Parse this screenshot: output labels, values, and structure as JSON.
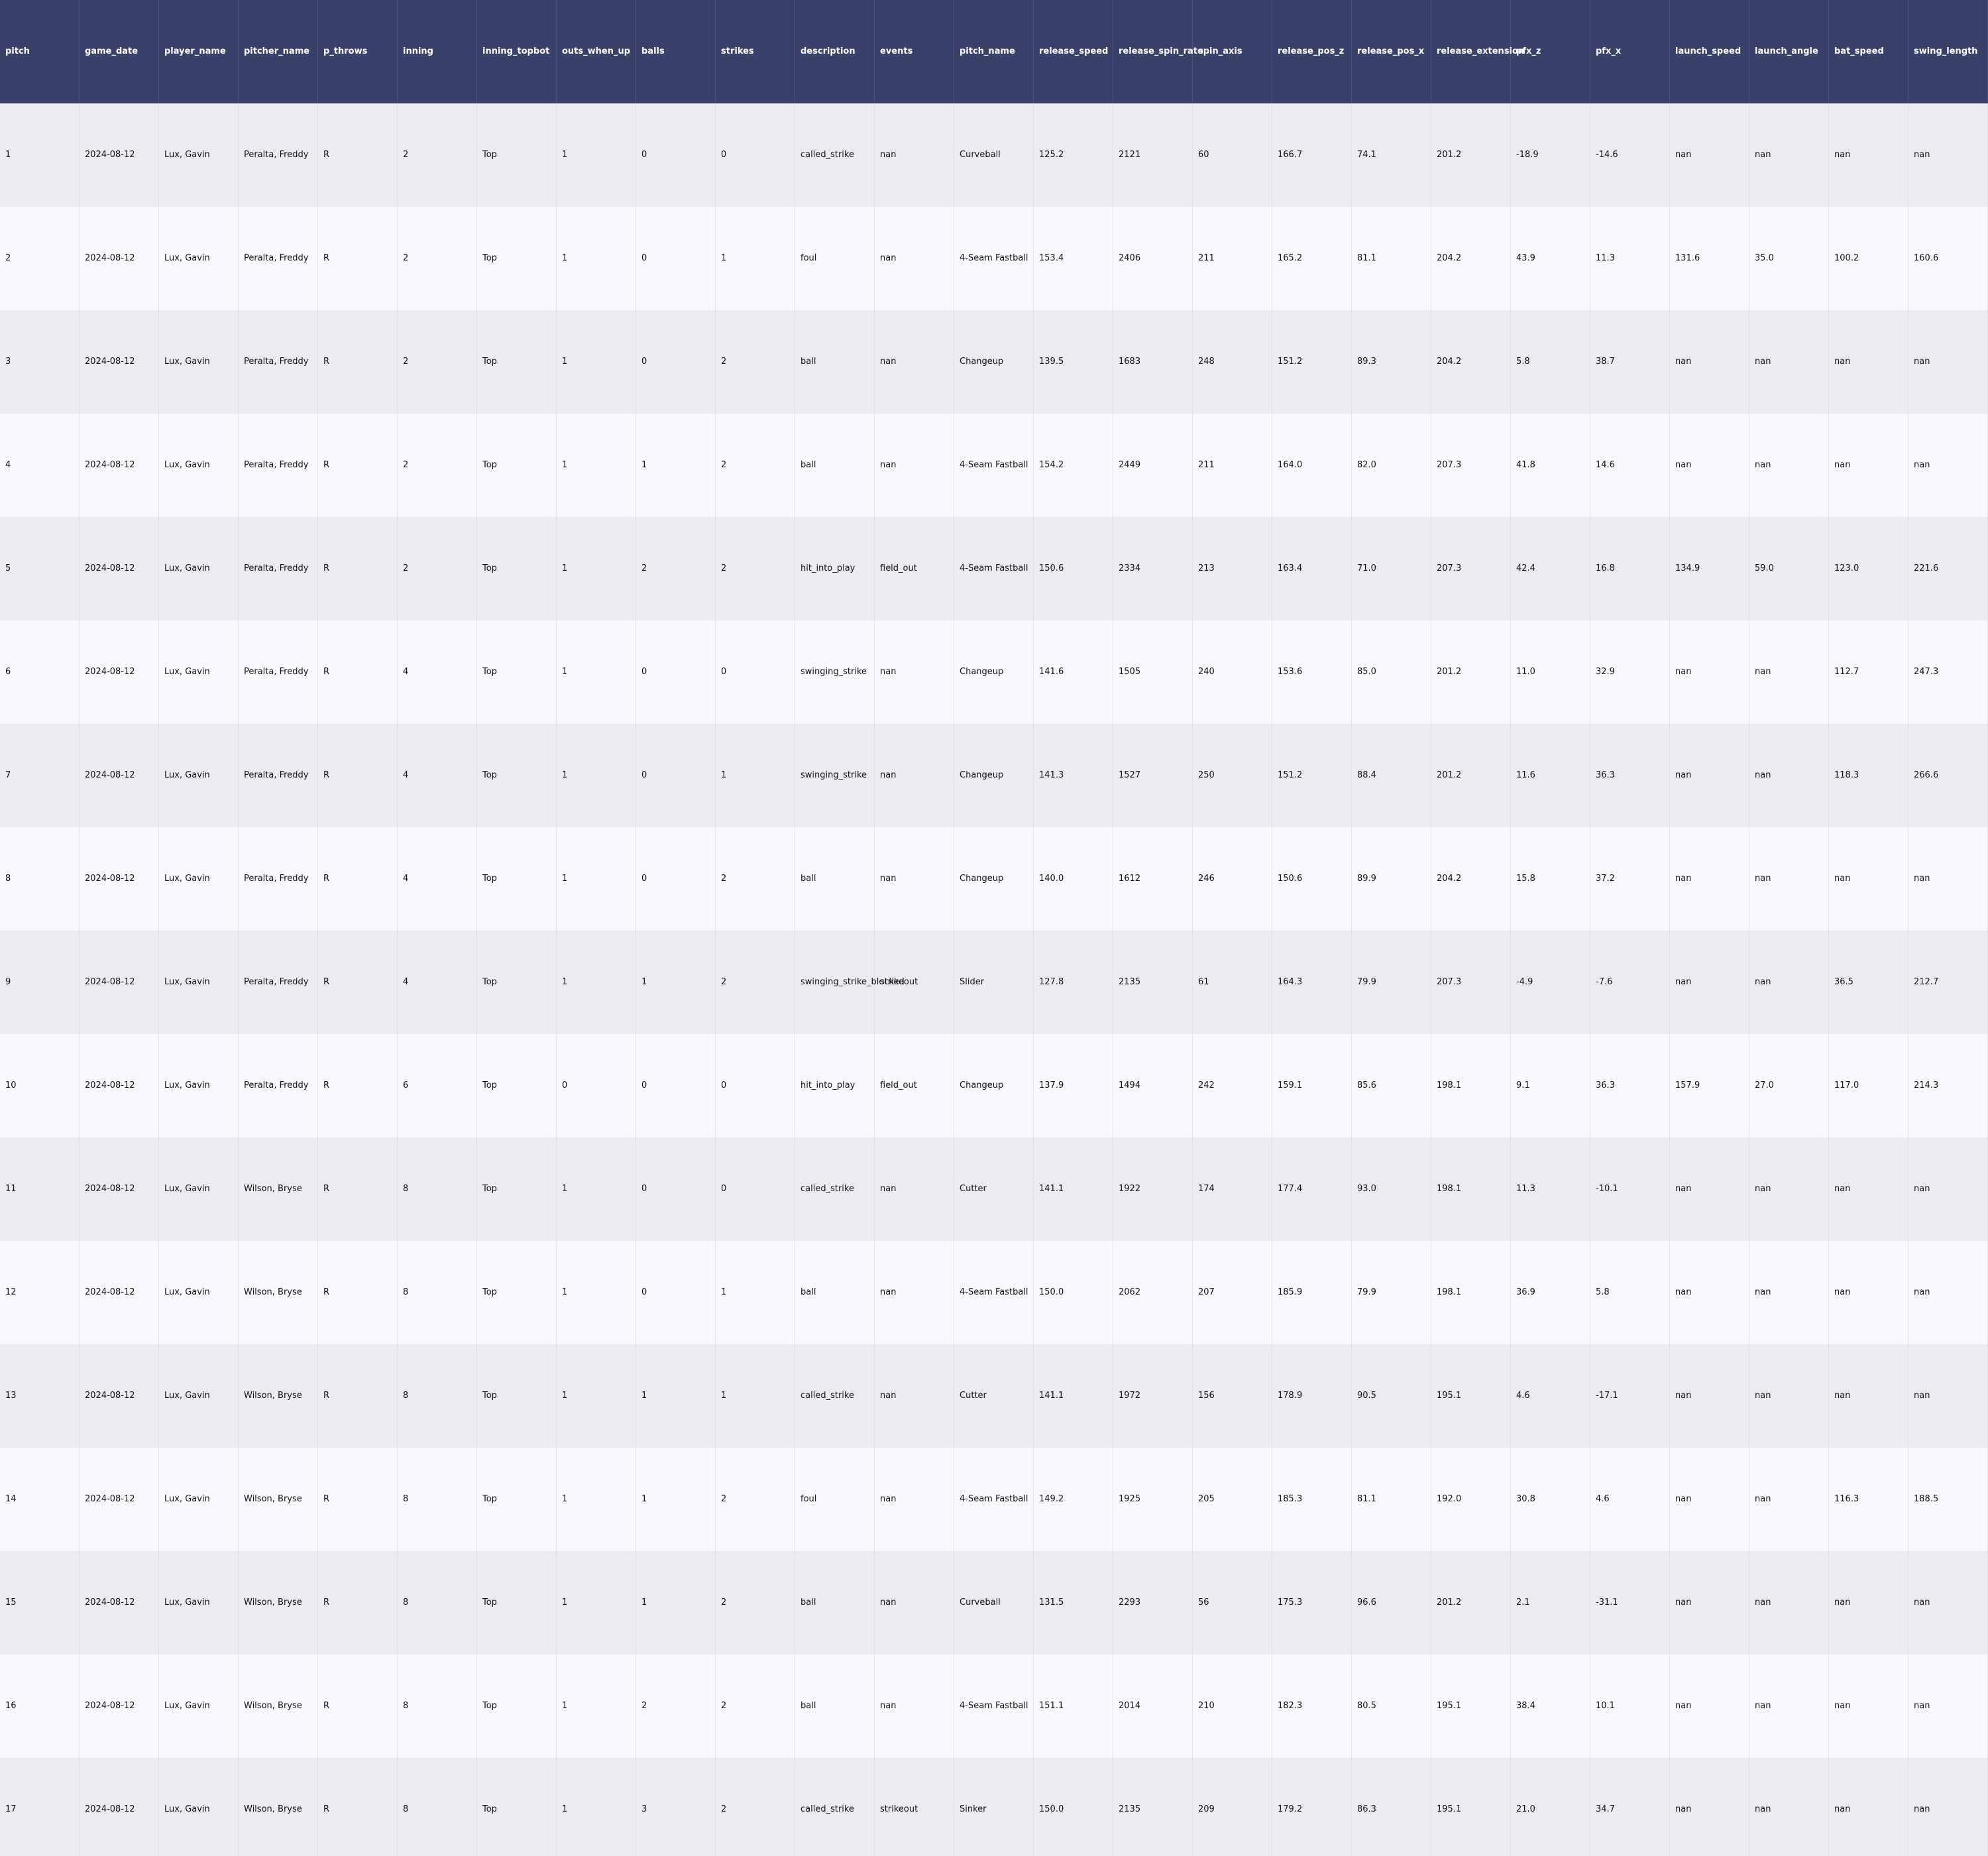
{
  "chart_data": {
    "type": "table",
    "colors": {
      "header_bg": "#39416b",
      "header_text": "#ffffff",
      "row_even_bg": "#ebecef",
      "row_odd_bg": "#f8f9fc",
      "cell_text": "#111111"
    },
    "columns": [
      "pitch",
      "game_date",
      "player_name",
      "pitcher_name",
      "p_throws",
      "inning",
      "inning_topbot",
      "outs_when_up",
      "balls",
      "strikes",
      "description",
      "events",
      "pitch_name",
      "release_speed",
      "release_spin_rate",
      "spin_axis",
      "release_pos_z",
      "release_pos_x",
      "release_extension",
      "pfx_z",
      "pfx_x",
      "launch_speed",
      "launch_angle",
      "bat_speed",
      "swing_length"
    ],
    "rows": [
      [
        "1",
        "2024-08-12",
        "Lux, Gavin",
        "Peralta, Freddy",
        "R",
        "2",
        "Top",
        "1",
        "0",
        "0",
        "called_strike",
        "nan",
        "Curveball",
        "125.2",
        "2121",
        "60",
        "166.7",
        "74.1",
        "201.2",
        "-18.9",
        "-14.6",
        "nan",
        "nan",
        "nan",
        "nan"
      ],
      [
        "2",
        "2024-08-12",
        "Lux, Gavin",
        "Peralta, Freddy",
        "R",
        "2",
        "Top",
        "1",
        "0",
        "1",
        "foul",
        "nan",
        "4-Seam Fastball",
        "153.4",
        "2406",
        "211",
        "165.2",
        "81.1",
        "204.2",
        "43.9",
        "11.3",
        "131.6",
        "35.0",
        "100.2",
        "160.6"
      ],
      [
        "3",
        "2024-08-12",
        "Lux, Gavin",
        "Peralta, Freddy",
        "R",
        "2",
        "Top",
        "1",
        "0",
        "2",
        "ball",
        "nan",
        "Changeup",
        "139.5",
        "1683",
        "248",
        "151.2",
        "89.3",
        "204.2",
        "5.8",
        "38.7",
        "nan",
        "nan",
        "nan",
        "nan"
      ],
      [
        "4",
        "2024-08-12",
        "Lux, Gavin",
        "Peralta, Freddy",
        "R",
        "2",
        "Top",
        "1",
        "1",
        "2",
        "ball",
        "nan",
        "4-Seam Fastball",
        "154.2",
        "2449",
        "211",
        "164.0",
        "82.0",
        "207.3",
        "41.8",
        "14.6",
        "nan",
        "nan",
        "nan",
        "nan"
      ],
      [
        "5",
        "2024-08-12",
        "Lux, Gavin",
        "Peralta, Freddy",
        "R",
        "2",
        "Top",
        "1",
        "2",
        "2",
        "hit_into_play",
        "field_out",
        "4-Seam Fastball",
        "150.6",
        "2334",
        "213",
        "163.4",
        "71.0",
        "207.3",
        "42.4",
        "16.8",
        "134.9",
        "59.0",
        "123.0",
        "221.6"
      ],
      [
        "6",
        "2024-08-12",
        "Lux, Gavin",
        "Peralta, Freddy",
        "R",
        "4",
        "Top",
        "1",
        "0",
        "0",
        "swinging_strike",
        "nan",
        "Changeup",
        "141.6",
        "1505",
        "240",
        "153.6",
        "85.0",
        "201.2",
        "11.0",
        "32.9",
        "nan",
        "nan",
        "112.7",
        "247.3"
      ],
      [
        "7",
        "2024-08-12",
        "Lux, Gavin",
        "Peralta, Freddy",
        "R",
        "4",
        "Top",
        "1",
        "0",
        "1",
        "swinging_strike",
        "nan",
        "Changeup",
        "141.3",
        "1527",
        "250",
        "151.2",
        "88.4",
        "201.2",
        "11.6",
        "36.3",
        "nan",
        "nan",
        "118.3",
        "266.6"
      ],
      [
        "8",
        "2024-08-12",
        "Lux, Gavin",
        "Peralta, Freddy",
        "R",
        "4",
        "Top",
        "1",
        "0",
        "2",
        "ball",
        "nan",
        "Changeup",
        "140.0",
        "1612",
        "246",
        "150.6",
        "89.9",
        "204.2",
        "15.8",
        "37.2",
        "nan",
        "nan",
        "nan",
        "nan"
      ],
      [
        "9",
        "2024-08-12",
        "Lux, Gavin",
        "Peralta, Freddy",
        "R",
        "4",
        "Top",
        "1",
        "1",
        "2",
        "swinging_strike_blocked",
        "strikeout",
        "Slider",
        "127.8",
        "2135",
        "61",
        "164.3",
        "79.9",
        "207.3",
        "-4.9",
        "-7.6",
        "nan",
        "nan",
        "36.5",
        "212.7"
      ],
      [
        "10",
        "2024-08-12",
        "Lux, Gavin",
        "Peralta, Freddy",
        "R",
        "6",
        "Top",
        "0",
        "0",
        "0",
        "hit_into_play",
        "field_out",
        "Changeup",
        "137.9",
        "1494",
        "242",
        "159.1",
        "85.6",
        "198.1",
        "9.1",
        "36.3",
        "157.9",
        "27.0",
        "117.0",
        "214.3"
      ],
      [
        "11",
        "2024-08-12",
        "Lux, Gavin",
        "Wilson, Bryse",
        "R",
        "8",
        "Top",
        "1",
        "0",
        "0",
        "called_strike",
        "nan",
        "Cutter",
        "141.1",
        "1922",
        "174",
        "177.4",
        "93.0",
        "198.1",
        "11.3",
        "-10.1",
        "nan",
        "nan",
        "nan",
        "nan"
      ],
      [
        "12",
        "2024-08-12",
        "Lux, Gavin",
        "Wilson, Bryse",
        "R",
        "8",
        "Top",
        "1",
        "0",
        "1",
        "ball",
        "nan",
        "4-Seam Fastball",
        "150.0",
        "2062",
        "207",
        "185.9",
        "79.9",
        "198.1",
        "36.9",
        "5.8",
        "nan",
        "nan",
        "nan",
        "nan"
      ],
      [
        "13",
        "2024-08-12",
        "Lux, Gavin",
        "Wilson, Bryse",
        "R",
        "8",
        "Top",
        "1",
        "1",
        "1",
        "called_strike",
        "nan",
        "Cutter",
        "141.1",
        "1972",
        "156",
        "178.9",
        "90.5",
        "195.1",
        "4.6",
        "-17.1",
        "nan",
        "nan",
        "nan",
        "nan"
      ],
      [
        "14",
        "2024-08-12",
        "Lux, Gavin",
        "Wilson, Bryse",
        "R",
        "8",
        "Top",
        "1",
        "1",
        "2",
        "foul",
        "nan",
        "4-Seam Fastball",
        "149.2",
        "1925",
        "205",
        "185.3",
        "81.1",
        "192.0",
        "30.8",
        "4.6",
        "nan",
        "nan",
        "116.3",
        "188.5"
      ],
      [
        "15",
        "2024-08-12",
        "Lux, Gavin",
        "Wilson, Bryse",
        "R",
        "8",
        "Top",
        "1",
        "1",
        "2",
        "ball",
        "nan",
        "Curveball",
        "131.5",
        "2293",
        "56",
        "175.3",
        "96.6",
        "201.2",
        "2.1",
        "-31.1",
        "nan",
        "nan",
        "nan",
        "nan"
      ],
      [
        "16",
        "2024-08-12",
        "Lux, Gavin",
        "Wilson, Bryse",
        "R",
        "8",
        "Top",
        "1",
        "2",
        "2",
        "ball",
        "nan",
        "4-Seam Fastball",
        "151.1",
        "2014",
        "210",
        "182.3",
        "80.5",
        "195.1",
        "38.4",
        "10.1",
        "nan",
        "nan",
        "nan",
        "nan"
      ],
      [
        "17",
        "2024-08-12",
        "Lux, Gavin",
        "Wilson, Bryse",
        "R",
        "8",
        "Top",
        "1",
        "3",
        "2",
        "called_strike",
        "strikeout",
        "Sinker",
        "150.0",
        "2135",
        "209",
        "179.2",
        "86.3",
        "195.1",
        "21.0",
        "34.7",
        "nan",
        "nan",
        "nan",
        "nan"
      ]
    ]
  }
}
